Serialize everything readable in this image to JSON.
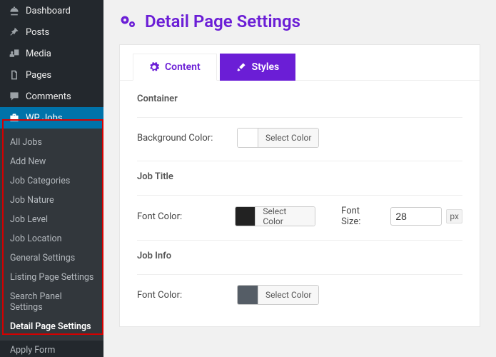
{
  "sidebar": {
    "top": [
      {
        "label": "Dashboard"
      },
      {
        "label": "Posts"
      },
      {
        "label": "Media"
      },
      {
        "label": "Pages"
      },
      {
        "label": "Comments"
      }
    ],
    "active": {
      "label": "WP Jobs"
    },
    "sub": [
      {
        "label": "All Jobs"
      },
      {
        "label": "Add New"
      },
      {
        "label": "Job Categories"
      },
      {
        "label": "Job Nature"
      },
      {
        "label": "Job Level"
      },
      {
        "label": "Job Location"
      },
      {
        "label": "General Settings"
      },
      {
        "label": "Listing Page Settings"
      },
      {
        "label": "Search Panel Settings"
      },
      {
        "label": "Detail Page Settings"
      }
    ],
    "after": [
      {
        "label": "Apply Form"
      }
    ]
  },
  "page": {
    "title": "Detail Page Settings",
    "tabs": {
      "content": "Content",
      "styles": "Styles"
    },
    "color_button": "Select Color",
    "px_unit": "px",
    "sections": {
      "container": {
        "title": "Container",
        "bg_label": "Background Color:"
      },
      "job_title": {
        "title": "Job Title",
        "font_color_label": "Font Color:",
        "font_size_label": "Font Size:",
        "font_size_value": "28"
      },
      "job_info": {
        "title": "Job Info",
        "font_color_label": "Font Color:"
      }
    }
  }
}
